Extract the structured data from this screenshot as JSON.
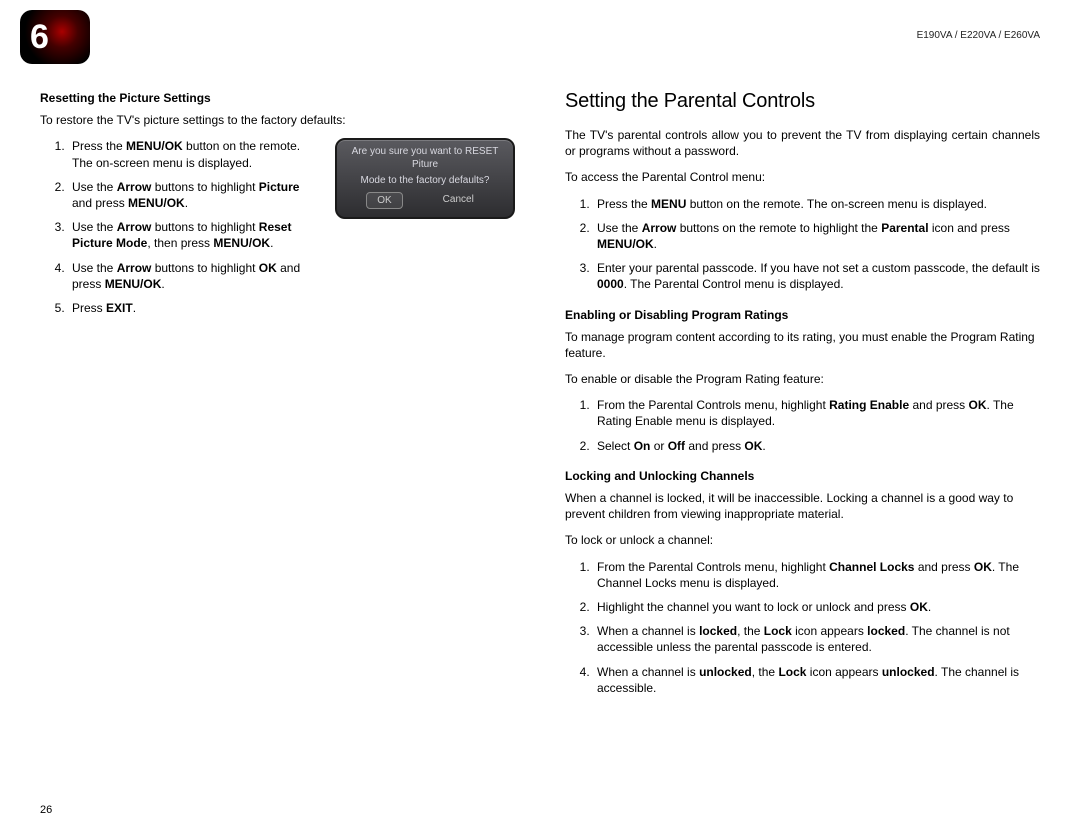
{
  "chapter_number": "6",
  "model_label": "E190VA / E220VA / E260VA",
  "page_number": "26",
  "left": {
    "subhead1": "Resetting the Picture Settings",
    "intro1": "To restore the TV's picture settings to the factory defaults:",
    "steps1": [
      "Press the <b>MENU/OK</b> button on the remote. The on-screen menu is displayed.",
      "Use the <b>Arrow</b> buttons to highlight <b>Picture</b> and press <b>MENU/OK</b>.",
      "Use the <b>Arrow</b> buttons to highlight <b>Reset Picture Mode</b>, then press <b>MENU/OK</b>.",
      "Use the <b>Arrow</b> buttons to highlight <b>OK</b> and press <b>MENU/OK</b>.",
      "Press <b>EXIT</b>."
    ],
    "dialog": {
      "line1": "Are you sure you want to RESET Piture",
      "line2": "Mode to the factory defaults?",
      "ok": "OK",
      "cancel": "Cancel"
    }
  },
  "right": {
    "section_title": "Setting the Parental Controls",
    "intro": "The TV's parental controls allow you to prevent the TV from displaying certain channels or programs without a password.",
    "access_intro": "To access the Parental Control menu:",
    "access_steps": [
      "Press the <b>MENU</b> button on the remote. The on-screen menu is displayed.",
      "Use the <b>Arrow</b> buttons on the remote to highlight the <b>Parental</b> icon and press <b>MENU/OK</b>.",
      "Enter your parental passcode. If you have not set a custom passcode, the default is <b>0000</b>. The Parental Control menu is displayed."
    ],
    "sub2": "Enabling or Disabling Program Ratings",
    "sub2_p1": "To manage program content according to its rating, you must enable the Program Rating feature.",
    "sub2_p2": "To enable or disable the Program Rating feature:",
    "sub2_steps": [
      "From the Parental Controls menu, highlight <b>Rating Enable</b> and press <b>OK</b>. The Rating Enable menu is displayed.",
      "Select <b>On</b> or <b>Off</b> and press <b>OK</b>."
    ],
    "sub3": "Locking and Unlocking Channels",
    "sub3_p1": "When a channel is locked, it will be inaccessible. Locking a channel is a good way to prevent children from viewing inappropriate material.",
    "sub3_p2": "To lock or unlock a channel:",
    "sub3_steps": [
      "From the Parental Controls menu, highlight <b>Channel Locks</b> and press <b>OK</b>. The Channel Locks menu is displayed.",
      "Highlight the channel you want to lock or unlock and press <b>OK</b>.",
      "When a channel is <b>locked</b>, the <b>Lock</b> icon appears <b>locked</b>. The channel is not accessible unless the parental passcode is entered.",
      "When a channel is <b>unlocked</b>, the <b>Lock</b> icon appears <b>unlocked</b>. The channel is accessible."
    ]
  }
}
